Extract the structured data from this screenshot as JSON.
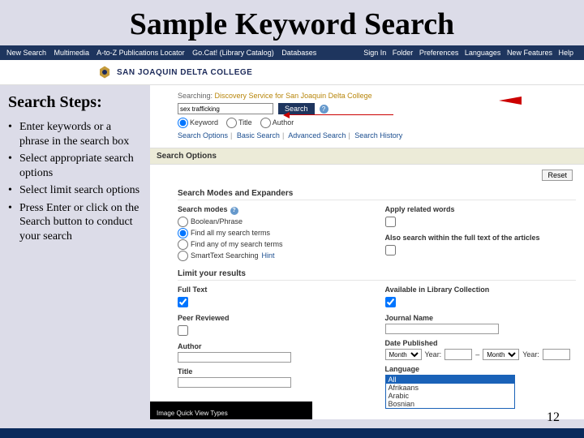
{
  "title": "Sample Keyword Search",
  "topnav_left": [
    "New Search",
    "Multimedia",
    "A-to-Z Publications Locator",
    "Go.Cat! (Library Catalog)",
    "Databases"
  ],
  "topnav_right": [
    "Sign In",
    "Folder",
    "Preferences",
    "Languages",
    "New Features",
    "Help"
  ],
  "college": {
    "name": "SAN JOAQUIN DELTA COLLEGE"
  },
  "sidebar": {
    "heading": "Search Steps:",
    "items": [
      "Enter keywords or a phrase in the search box",
      "Select appropriate search options",
      "Select limit search options",
      "Press Enter or click on the Search button to conduct your search"
    ]
  },
  "search": {
    "label": "Searching:",
    "service": "Discovery Service for San Joaquin Delta College",
    "value": "sex trafficking",
    "button": "Search",
    "fields": [
      {
        "value": "Keyword",
        "checked": true
      },
      {
        "value": "Title",
        "checked": false
      },
      {
        "value": "Author",
        "checked": false
      }
    ],
    "links": [
      "Search Options",
      "Basic Search",
      "Advanced Search",
      "Search History"
    ]
  },
  "options": {
    "header": "Search Options",
    "reset": "Reset",
    "modes_header": "Search Modes and Expanders",
    "modes_label": "Search modes",
    "modes": [
      "Boolean/Phrase",
      "Find all my search terms",
      "Find any of my search terms",
      "SmartText Searching"
    ],
    "hint": "Hint",
    "apply_related": "Apply related words",
    "also_fulltext": "Also search within the full text of the articles",
    "limit_header": "Limit your results",
    "full_text": "Full Text",
    "peer": "Peer Reviewed",
    "author": "Author",
    "title": "Title",
    "available": "Available in Library Collection",
    "journal": "Journal Name",
    "date_pub": "Date Published",
    "month": "Month",
    "year": "Year:",
    "dash": "–",
    "language": "Language",
    "lang_opts": [
      "All",
      "Afrikaans",
      "Arabic",
      "Bosnian"
    ]
  },
  "page_number": "12",
  "footer_caption": "Image Quick View Types"
}
